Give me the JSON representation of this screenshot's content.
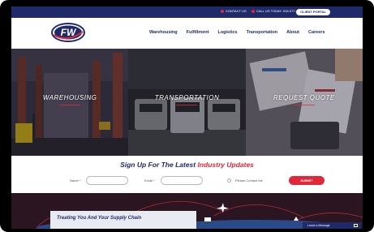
{
  "topbar": {
    "contact_us": "CONTACT US",
    "call_today": "CALL US TODAY: 618-577-XXXX",
    "client_portal": "CLIENT PORTAL"
  },
  "logo": {
    "text": "FW"
  },
  "nav": {
    "items": [
      {
        "label": "Warehousing"
      },
      {
        "label": "Fulfillment"
      },
      {
        "label": "Logistics"
      },
      {
        "label": "Transportation"
      },
      {
        "label": "About"
      },
      {
        "label": "Careers"
      }
    ]
  },
  "hero": {
    "panels": [
      {
        "title": "WAREHOUSING"
      },
      {
        "title": "TRANSPORTATION"
      },
      {
        "title": "REQUEST QUOTE"
      }
    ]
  },
  "signup": {
    "heading_main": "Sign Up For The Latest ",
    "heading_accent": "Industry Updates",
    "name_label": "Name *",
    "email_label": "Email *",
    "contact_label": "Please Contact Me",
    "submit_label": "SUBMIT"
  },
  "bottom": {
    "card_text": "Treating You And Your Supply Chain",
    "chat_label": "Leave a Message"
  },
  "colors": {
    "navy": "#1f2a6b",
    "accent_red": "#e0283a"
  }
}
